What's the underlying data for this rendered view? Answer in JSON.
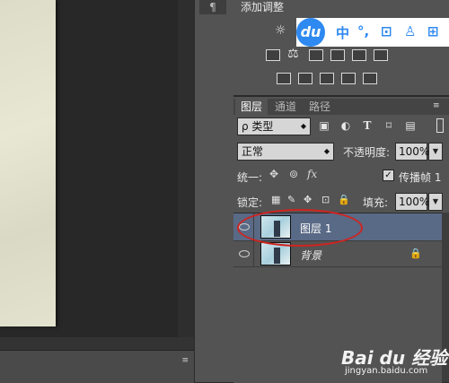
{
  "adjustments": {
    "title": "添加调整"
  },
  "baidu_toolbar": {
    "logo": "du",
    "items": [
      "中",
      "°,",
      "⊡",
      "♙",
      "⊞"
    ]
  },
  "colors": {
    "baidu_blue": "#2e89f0",
    "selected_layer": "#596a86",
    "annotation_red": "#d0231f"
  },
  "layers_panel": {
    "tabs": [
      "图层",
      "通道",
      "路径"
    ],
    "kind_filter": "ρ 类型",
    "filter_icons": [
      "image-filter-icon",
      "adjustment-filter-icon",
      "text-filter-icon",
      "shape-filter-icon",
      "smart-object-filter-icon"
    ],
    "blend_mode": "正常",
    "opacity_label": "不透明度:",
    "opacity_value": "100%",
    "unify_label": "统一:",
    "propagate_label": "传播帧 1",
    "propagate_checked": true,
    "lock_label": "锁定:",
    "fill_label": "填充:",
    "fill_value": "100%",
    "layers": [
      {
        "name": "图层 1",
        "selected": true,
        "visible": true
      },
      {
        "name": "背景",
        "selected": false,
        "visible": true,
        "locked": true
      }
    ]
  },
  "text_glyphs": {
    "filter_text": "T",
    "unify_fx": "fx",
    "pilcrow": "¶",
    "menu": "≡"
  },
  "watermark": {
    "logo": "Bai du 经验",
    "url": "jingyan.baidu.com"
  }
}
